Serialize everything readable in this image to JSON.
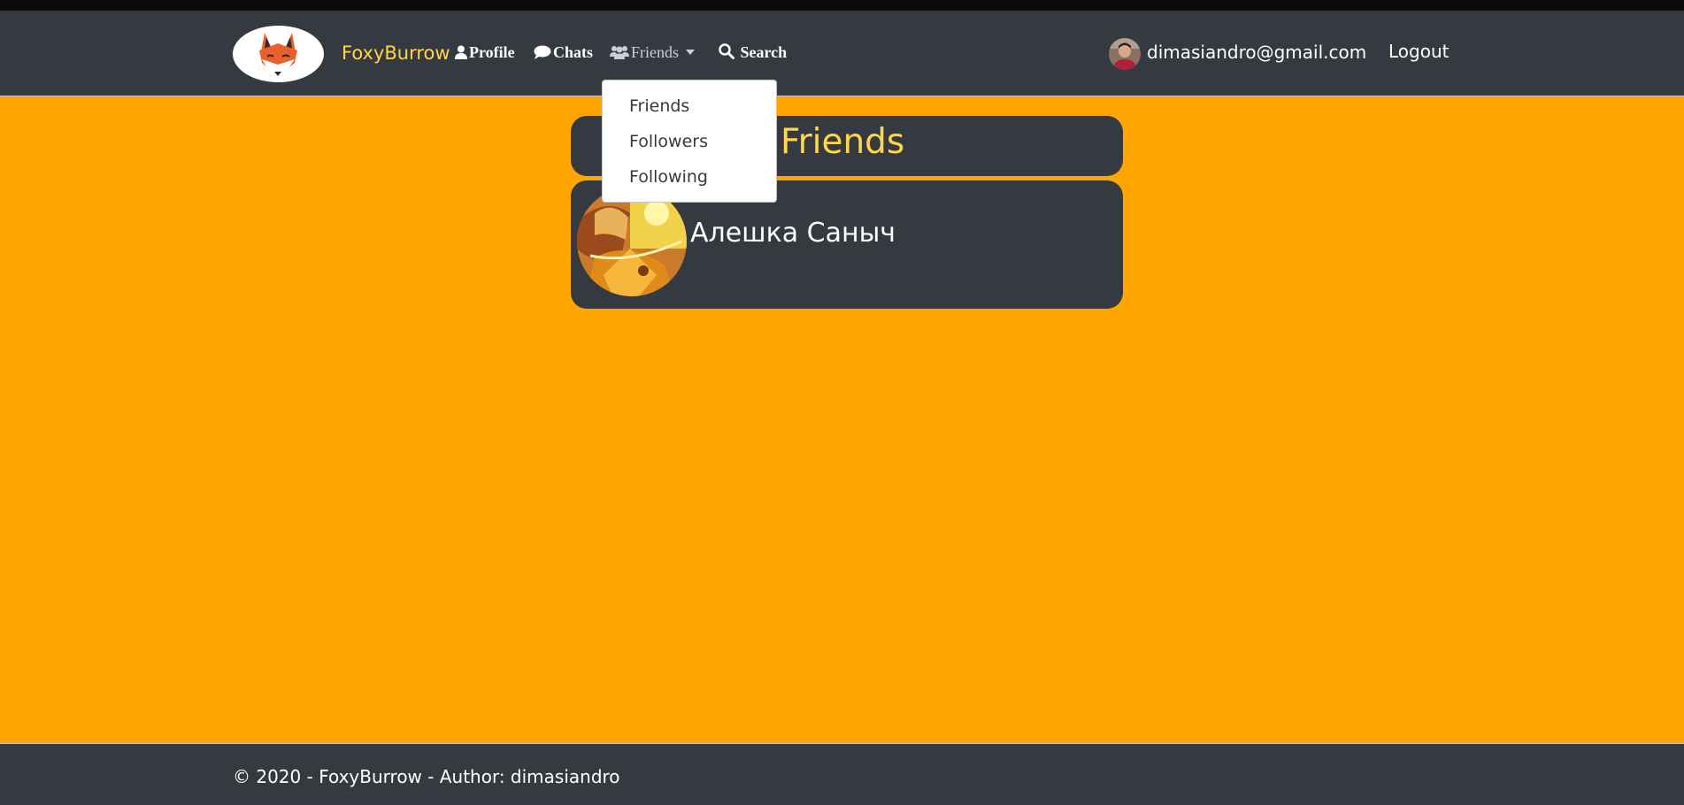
{
  "brand": {
    "name": "FoxyBurrow",
    "logo_icon": "fox-logo-icon"
  },
  "nav": {
    "profile": "Profile",
    "chats": "Chats",
    "friends": "Friends",
    "search": "Search"
  },
  "friends_menu": {
    "items": [
      "Friends",
      "Followers",
      "Following"
    ]
  },
  "user": {
    "email": "dimasiandro@gmail.com",
    "logout": "Logout"
  },
  "page": {
    "title": "Friends"
  },
  "friends": [
    {
      "name": "Алешка Саныч"
    }
  ],
  "footer": {
    "text": "© 2020 - FoxyBurrow - Author: dimasiandro"
  },
  "colors": {
    "background": "#ffa500",
    "navbar": "#343a40",
    "accent": "#ffd54a",
    "text": "#ffffff"
  }
}
